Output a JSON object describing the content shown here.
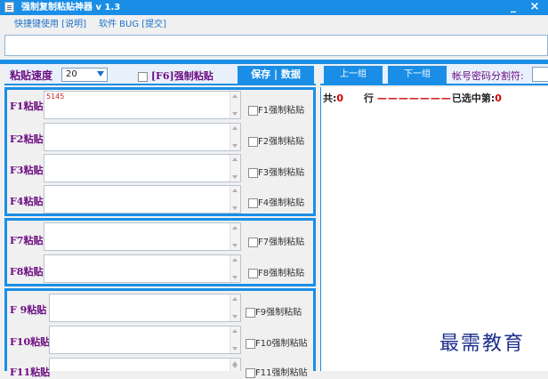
{
  "window": {
    "title": "强制复制粘贴神器 v 1.3",
    "minimize": "_",
    "close": "×"
  },
  "menu": {
    "shortcut": "快捷键使用 [说明]",
    "bug": "软件 BUG [提交]"
  },
  "toolbar": {
    "speed_label": "粘贴速度",
    "speed_value": "20",
    "f6_force": "[F6]强制粘贴",
    "save_data": "保存 | 数据"
  },
  "rows": [
    {
      "label": "F1粘贴",
      "value": "5145",
      "check": "F1强制粘贴"
    },
    {
      "label": "F2粘贴",
      "value": "",
      "check": "F2强制粘贴"
    },
    {
      "label": "F3粘贴",
      "value": "",
      "check": "F3强制粘贴"
    },
    {
      "label": "F4粘贴",
      "value": "",
      "check": "F4强制粘贴"
    },
    {
      "label": "F7粘贴",
      "value": "",
      "check": "F7强制粘贴"
    },
    {
      "label": "F8粘贴",
      "value": "",
      "check": "F8强制粘贴"
    },
    {
      "label": "F 9粘贴",
      "value": "",
      "check": "F9强制粘贴"
    },
    {
      "label": "F10粘贴",
      "value": "",
      "check": "F10强制粘贴"
    },
    {
      "label": "F11粘贴",
      "value": "",
      "check": "F11强制粘贴"
    }
  ],
  "right": {
    "prev_group": "上一组",
    "next_group": "下一组",
    "separator_label": "帐号密码分割符:",
    "status": {
      "total_label": "共:",
      "total_value": "0",
      "row_label": "行",
      "dashes": "———————",
      "selected_label": "已选中第:",
      "selected_value": "0"
    }
  },
  "watermark": "最需教育",
  "colors": {
    "accent": "#1a8ee6",
    "label_purple": "#6d0f82",
    "status_red": "#d00000"
  }
}
